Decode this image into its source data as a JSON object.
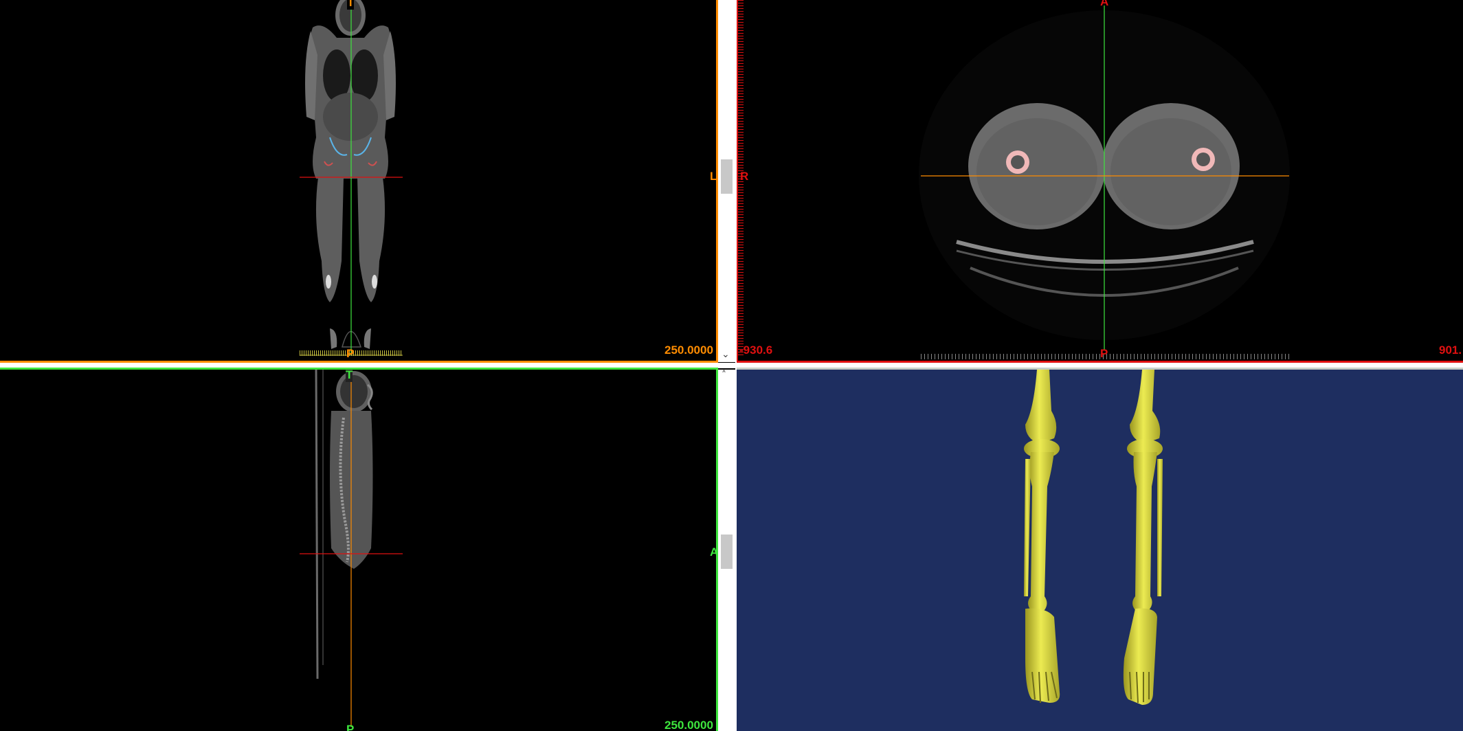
{
  "colors": {
    "coronal": "#ff8c00",
    "axial": "#e01010",
    "sagittal": "#3ee63e",
    "render_bg": "#1e2e60",
    "bone": "#e2e040"
  },
  "coronal_view": {
    "top_marker": "T",
    "bottom_marker": "P",
    "left_marker": "L",
    "scale_value": "250.0000"
  },
  "axial_view": {
    "top_marker": "A",
    "bottom_marker": "P",
    "left_marker": "R",
    "left_value": "-930.6",
    "right_value": "901."
  },
  "sagittal_view": {
    "top_marker": "T",
    "bottom_marker": "P",
    "right_marker": "A",
    "scale_value": "250.0000"
  },
  "render_view": {
    "content": "3d-bone-rendering-legs"
  }
}
